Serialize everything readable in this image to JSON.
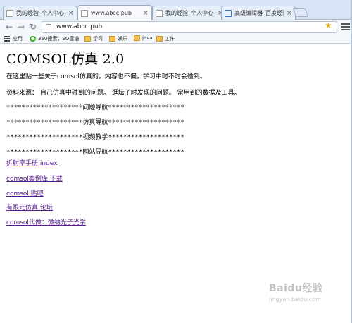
{
  "browser": {
    "tabs": [
      {
        "title": "我的经验_个人中心_百"
      },
      {
        "title": "www.abcc.pub"
      },
      {
        "title": "我的经验_个人中心_百"
      },
      {
        "title": "高级编辑器_百度经验"
      }
    ],
    "tab_close_glyph": "×",
    "address": "www.abcc.pub",
    "bookmarks": [
      {
        "label": "应用",
        "icon": "apps-grid-icon"
      },
      {
        "label": "360搜索，SO靠谱",
        "icon": "360-search-icon"
      },
      {
        "label": "学习",
        "icon": "folder-icon"
      },
      {
        "label": "娱乐",
        "icon": "folder-icon"
      },
      {
        "label": "java",
        "icon": "folder-icon"
      },
      {
        "label": "工作",
        "icon": "folder-icon"
      }
    ]
  },
  "page": {
    "heading": "COMSOL仿真 2.0",
    "intro": "在这里贴一些关于comsol仿真的。内容也不偏，学习中时不时会碰到。",
    "sources": "资料来源：  自己仿真中碰到的问题。 逛坛子时发现的问题。 常用到的数据及工具。",
    "nav_lines": [
      "********************问题导航********************",
      "********************仿真导航********************",
      "********************视频教学********************",
      "********************网站导航********************"
    ],
    "links": [
      "折射率手册 index",
      "comsol案例库 下载",
      "comsol 贴吧",
      "有限元仿真 论坛",
      "comsol代做：微纳光子光学"
    ]
  },
  "watermark": {
    "line1": "Baidu经验",
    "line2": "jingyan.baidu.com"
  },
  "colors": {
    "link_visited": "#551a8b",
    "tabstrip": "#d7e4f5",
    "star": "#e8a317"
  }
}
